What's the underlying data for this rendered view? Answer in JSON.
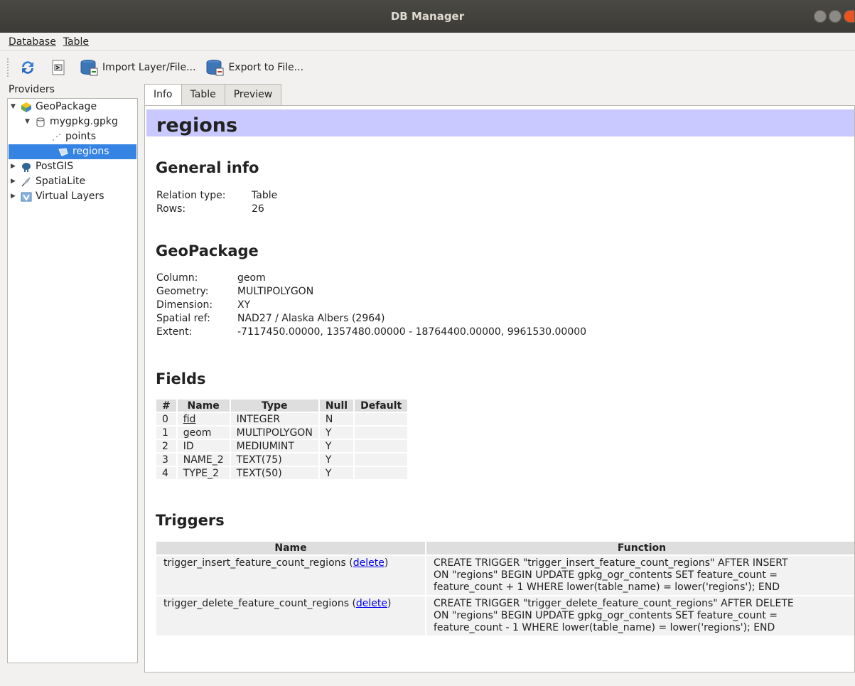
{
  "window": {
    "title": "DB Manager"
  },
  "menubar": {
    "items": [
      "Database",
      "Table"
    ]
  },
  "toolbar": {
    "import_label": "Import Layer/File...",
    "export_label": "Export to File..."
  },
  "providers": {
    "title": "Providers",
    "tree": [
      {
        "label": "GeoPackage"
      },
      {
        "label": "mygpkg.gpkg"
      },
      {
        "label": "points"
      },
      {
        "label": "regions"
      },
      {
        "label": "PostGIS"
      },
      {
        "label": "SpatiaLite"
      },
      {
        "label": "Virtual Layers"
      }
    ]
  },
  "tabs": [
    "Info",
    "Table",
    "Preview"
  ],
  "info": {
    "title": "regions",
    "general": {
      "heading": "General info",
      "rows": [
        {
          "key": "Relation type:",
          "value": "Table"
        },
        {
          "key": "Rows:",
          "value": "26"
        }
      ]
    },
    "geopackage": {
      "heading": "GeoPackage",
      "rows": [
        {
          "key": "Column:",
          "value": "geom"
        },
        {
          "key": "Geometry:",
          "value": "MULTIPOLYGON"
        },
        {
          "key": "Dimension:",
          "value": "XY"
        },
        {
          "key": "Spatial ref:",
          "value": "NAD27 / Alaska Albers (2964)"
        },
        {
          "key": "Extent:",
          "value": "-7117450.00000, 1357480.00000 - 18764400.00000, 9961530.00000"
        }
      ]
    },
    "fields": {
      "heading": "Fields",
      "columns": [
        "#",
        "Name",
        "Type",
        "Null",
        "Default"
      ],
      "rows": [
        [
          "0",
          "fid",
          "INTEGER",
          "N",
          ""
        ],
        [
          "1",
          "geom",
          "MULTIPOLYGON",
          "Y",
          ""
        ],
        [
          "2",
          "ID",
          "MEDIUMINT",
          "Y",
          ""
        ],
        [
          "3",
          "NAME_2",
          "TEXT(75)",
          "Y",
          ""
        ],
        [
          "4",
          "TYPE_2",
          "TEXT(50)",
          "Y",
          ""
        ]
      ]
    },
    "triggers": {
      "heading": "Triggers",
      "columns": [
        "Name",
        "Function"
      ],
      "delete_label": "delete",
      "rows": [
        {
          "name": "trigger_insert_feature_count_regions",
          "function_lines": [
            "CREATE TRIGGER \"trigger_insert_feature_count_regions\" AFTER INSERT",
            "ON \"regions\" BEGIN UPDATE gpkg_ogr_contents SET feature_count =",
            "feature_count + 1 WHERE lower(table_name) = lower('regions'); END"
          ]
        },
        {
          "name": "trigger_delete_feature_count_regions",
          "function_lines": [
            "CREATE TRIGGER \"trigger_delete_feature_count_regions\" AFTER DELETE",
            "ON \"regions\" BEGIN UPDATE gpkg_ogr_contents SET feature_count =",
            "feature_count - 1 WHERE lower(table_name) = lower('regions'); END"
          ]
        }
      ]
    }
  }
}
